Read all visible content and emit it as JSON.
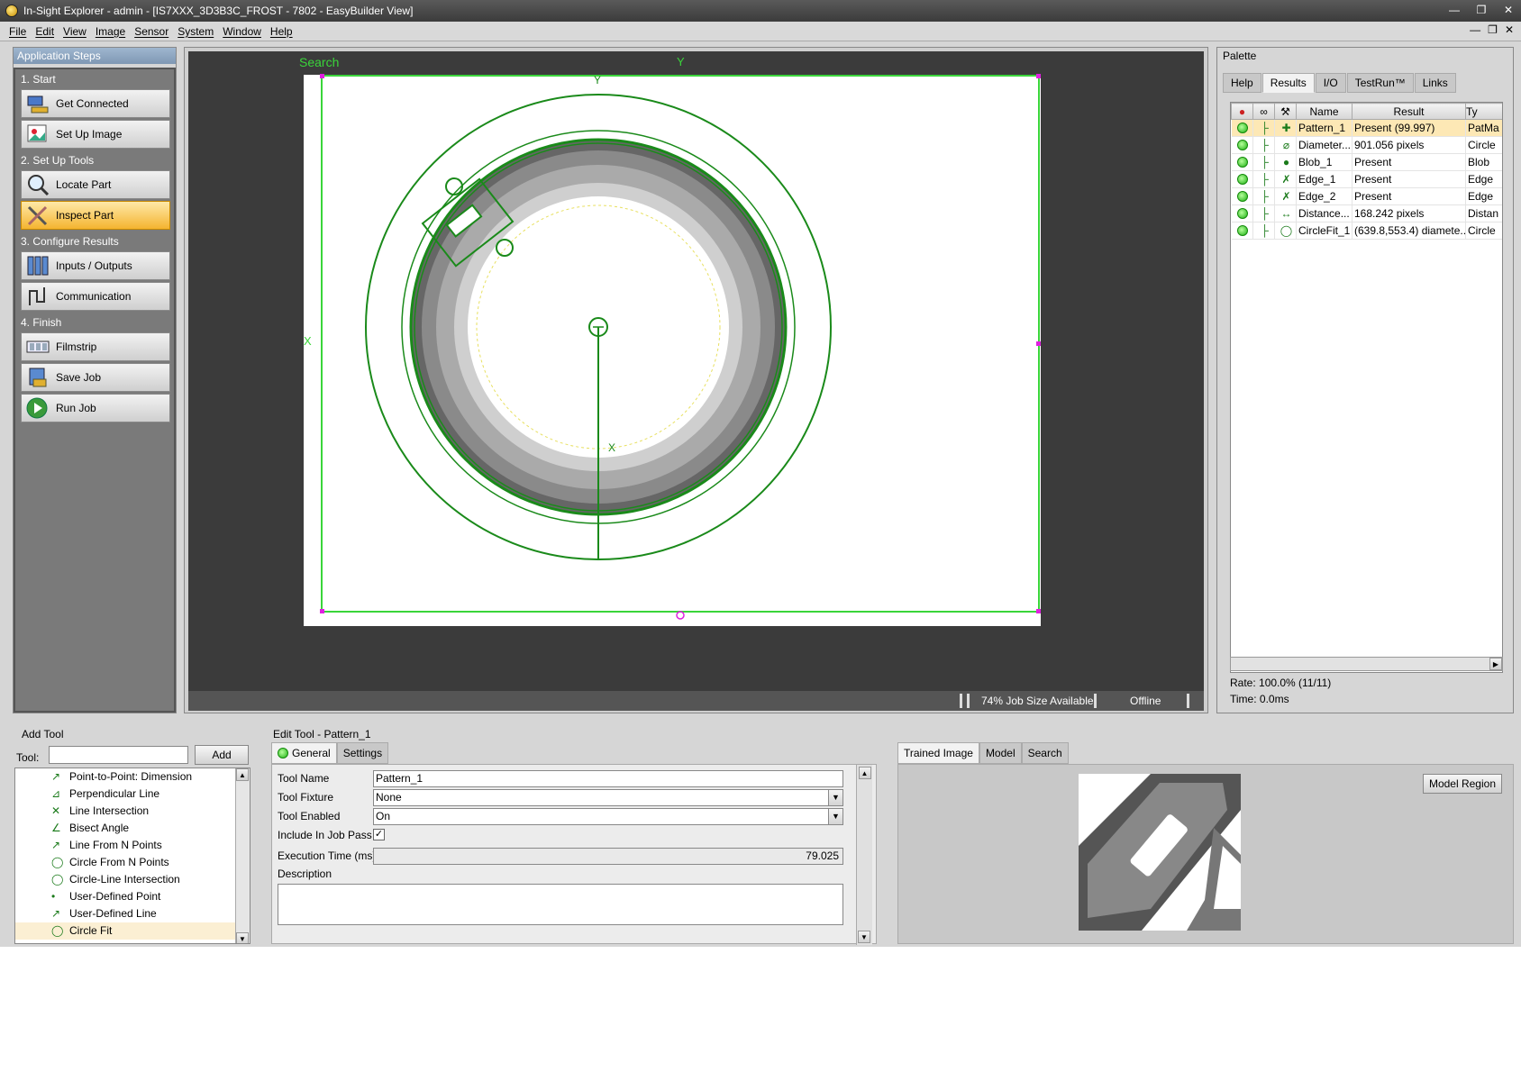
{
  "window": {
    "title": "In-Sight Explorer - admin - [IS7XXX_3D3B3C_FROST - 7802 - EasyBuilder View]"
  },
  "menu": [
    "File",
    "Edit",
    "View",
    "Image",
    "Sensor",
    "System",
    "Window",
    "Help"
  ],
  "app_steps": {
    "header": "Application Steps",
    "groups": [
      {
        "title": "1. Start",
        "items": [
          "Get Connected",
          "Set Up Image"
        ]
      },
      {
        "title": "2. Set Up Tools",
        "items": [
          "Locate Part",
          "Inspect Part"
        ]
      },
      {
        "title": "3. Configure Results",
        "items": [
          "Inputs / Outputs",
          "Communication"
        ]
      },
      {
        "title": "4. Finish",
        "items": [
          "Filmstrip",
          "Save Job",
          "Run Job"
        ]
      }
    ],
    "active_item": "Inspect Part"
  },
  "viewer": {
    "search_label": "Search",
    "axis_y": "Y",
    "axis_x": "X",
    "status": {
      "job_size": "74% Job Size Available",
      "connection": "Offline"
    }
  },
  "palette": {
    "header": "Palette",
    "tabs": [
      "Help",
      "Results",
      "I/O",
      "TestRun™",
      "Links"
    ],
    "active_tab": "Results",
    "columns": [
      "Name",
      "Result",
      "Ty"
    ],
    "rows": [
      {
        "name": "Pattern_1",
        "result": "Present (99.997)",
        "type": "PatMa",
        "selected": true,
        "icon": "pattern-icon"
      },
      {
        "name": "Diameter...",
        "result": "901.056 pixels",
        "type": "Circle",
        "icon": "diameter-icon"
      },
      {
        "name": "Blob_1",
        "result": "Present",
        "type": "Blob",
        "icon": "blob-icon"
      },
      {
        "name": "Edge_1",
        "result": "Present",
        "type": "Edge",
        "icon": "edge-icon"
      },
      {
        "name": "Edge_2",
        "result": "Present",
        "type": "Edge",
        "icon": "edge-icon"
      },
      {
        "name": "Distance...",
        "result": "168.242 pixels",
        "type": "Distan",
        "icon": "distance-icon"
      },
      {
        "name": "CircleFit_1",
        "result": "(639.8,553.4)  diamete...",
        "type": "Circle",
        "icon": "circlefit-icon"
      }
    ],
    "rate": "Rate: 100.0% (11/11)",
    "time": "Time: 0.0ms"
  },
  "add_tool": {
    "header": "Add Tool",
    "tool_label": "Tool:",
    "tool_value": "",
    "add_label": "Add",
    "items": [
      "Point-to-Point: Dimension",
      "Perpendicular Line",
      "Line Intersection",
      "Bisect Angle",
      "Line From N Points",
      "Circle From N Points",
      "Circle-Line Intersection",
      "User-Defined Point",
      "User-Defined Line",
      "Circle Fit"
    ],
    "selected": "Circle Fit"
  },
  "edit_tool": {
    "header": "Edit Tool - Pattern_1",
    "tabs": [
      "General",
      "Settings"
    ],
    "fields": {
      "tool_name_label": "Tool Name",
      "tool_name": "Pattern_1",
      "tool_fixture_label": "Tool Fixture",
      "tool_fixture": "None",
      "tool_enabled_label": "Tool Enabled",
      "tool_enabled": "On",
      "include_label": "Include In Job Pass",
      "exec_label": "Execution Time (ms)",
      "exec_time": "79.025",
      "description_label": "Description"
    }
  },
  "trained": {
    "tabs": [
      "Trained Image",
      "Model",
      "Search"
    ],
    "model_region_label": "Model Region"
  }
}
